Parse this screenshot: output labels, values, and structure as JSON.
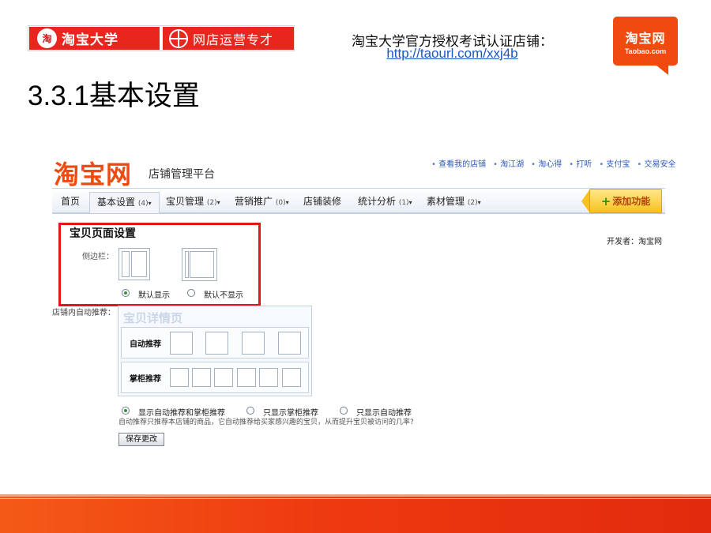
{
  "banner": {
    "left_badge": "淘",
    "left_text": "淘宝大学",
    "right_text": "网店运营专才"
  },
  "auth": {
    "line": "淘宝大学官方授权考试认证店铺：",
    "link": "http://taourl.com/xxj4b"
  },
  "taobao_logo": {
    "line1": "淘宝网",
    "line2": "Taobao.com"
  },
  "slide_title": "3.3.1基本设置",
  "platform": {
    "logo_text": "淘宝网",
    "name": "店铺管理平台",
    "top_links": [
      "查看我的店铺",
      "淘江湖",
      "淘心得",
      "打听",
      "支付宝",
      "交易安全"
    ]
  },
  "nav": {
    "home": "首页",
    "basic": {
      "label": "基本设置",
      "count": "(4)"
    },
    "items": {
      "label": "宝贝管理",
      "count": "(2)"
    },
    "promo": {
      "label": "营销推广",
      "count": "(0)"
    },
    "decor": "店铺装修",
    "stats": {
      "label": "统计分析",
      "count": "(1)"
    },
    "assets": {
      "label": "素材管理",
      "count": "(2)"
    },
    "add_func": "添加功能"
  },
  "settings": {
    "section_title": "宝贝页面设置",
    "developer": "开发者：淘宝网",
    "sidebar_label": "侧边栏：",
    "sidebar_opt_show": "默认显示",
    "sidebar_opt_hide": "默认不显示",
    "auto_label": "店铺内自动推荐：",
    "watermark": "宝贝详情页",
    "row_auto": "自动推荐",
    "row_shop": "掌柜推荐",
    "rec_opt_both": "显示自动推荐和掌柜推荐",
    "rec_opt_shop": "只显示掌柜推荐",
    "rec_opt_auto": "只显示自动推荐",
    "hint": "自动推荐只推荐本店铺的商品，它自动推荐给买家感兴趣的宝贝，从而提升宝贝被访问的几率?",
    "save_label": "保存更改"
  },
  "colors": {
    "brand_orange": "#f04a0e",
    "banner_red": "#e8261d",
    "highlight_red": "#e0161b",
    "link_blue": "#1a56c5"
  }
}
